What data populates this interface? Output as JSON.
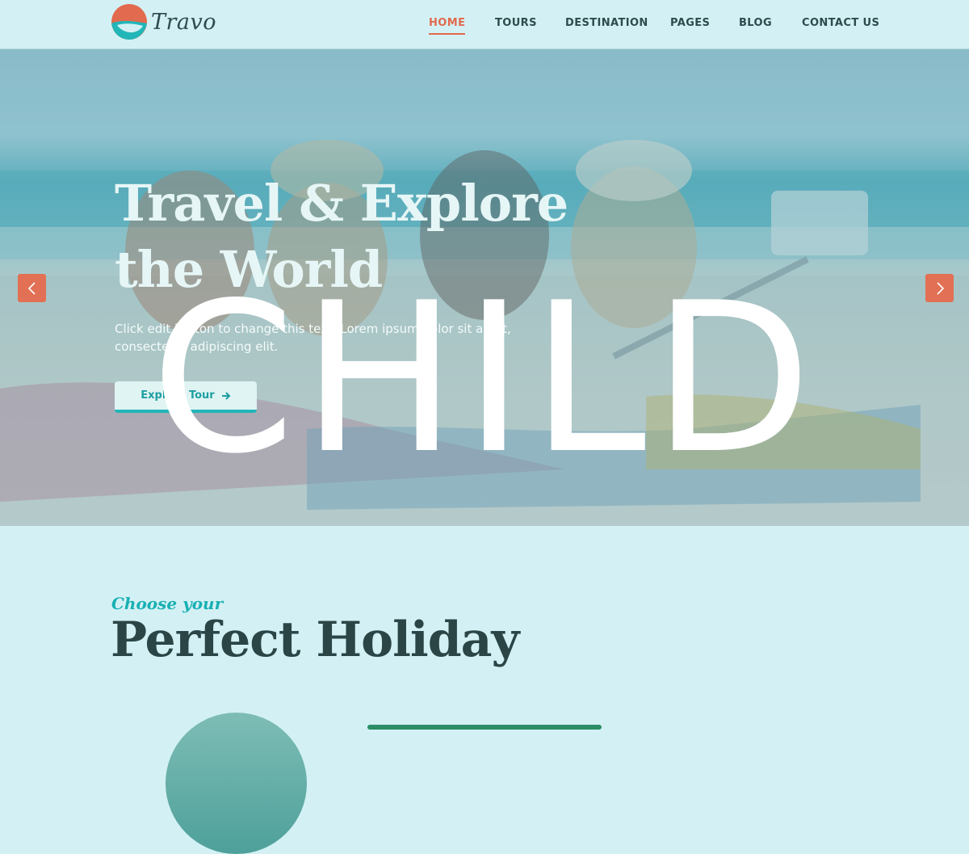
{
  "brand": {
    "name": "Travo"
  },
  "nav": {
    "items": [
      {
        "label": "HOME",
        "active": true
      },
      {
        "label": "TOURS"
      },
      {
        "label": "DESTINATION"
      },
      {
        "label": "PAGES"
      },
      {
        "label": "BLOG"
      },
      {
        "label": "CONTACT US"
      }
    ]
  },
  "hero": {
    "title_line1": "Travel & Explore",
    "title_line2": "the World",
    "description": "Click edit button to change this text. Lorem ipsum dolor sit amet, consectetur adipiscing elit.",
    "button_label": "Explore Tour",
    "prev_icon": "chevron-left-icon",
    "next_icon": "chevron-right-icon",
    "watermark": "CHILD"
  },
  "section": {
    "subtitle": "Choose your",
    "title": "Perfect Holiday"
  },
  "colors": {
    "background": "#d3f1f4",
    "accent": "#e26a4e",
    "teal": "#21b6b8",
    "heading": "#2b4547"
  }
}
